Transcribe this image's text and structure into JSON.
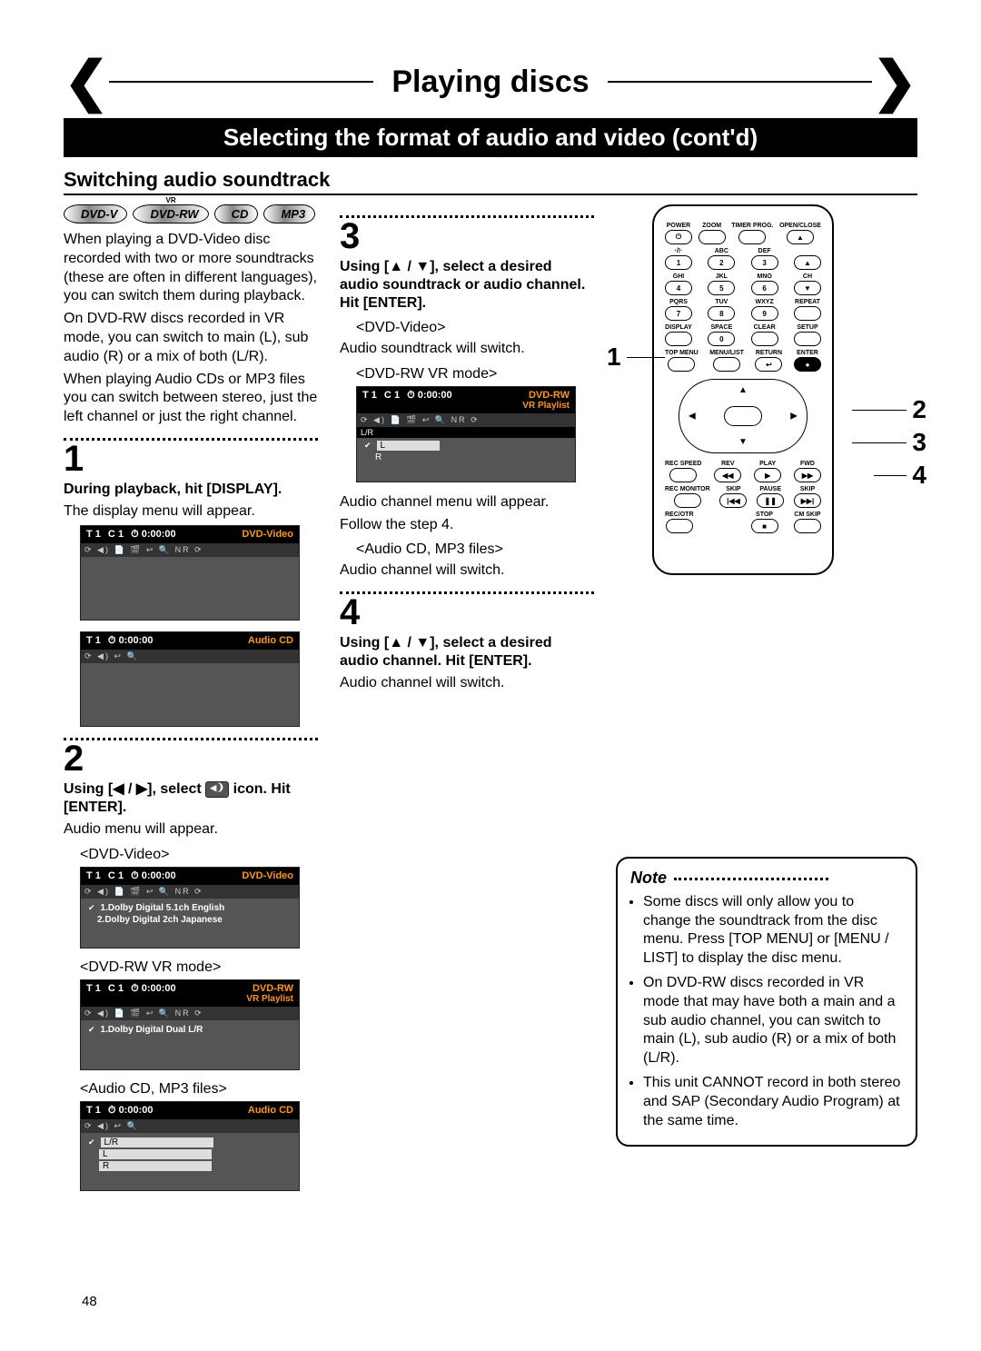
{
  "header": {
    "page_title": "Playing discs",
    "subtitle": "Selecting the format of audio and video (cont'd)",
    "section": "Switching audio soundtrack"
  },
  "badges": [
    "DVD-V",
    "DVD-RW",
    "CD",
    "MP3"
  ],
  "badge_vr": "VR",
  "intro": {
    "p1": "When playing a DVD-Video disc recorded with two or more soundtracks (these are often in different languages), you can switch them during playback.",
    "p2": "On DVD-RW discs recorded in VR mode, you can switch to main (L), sub audio (R) or a mix of both (L/R).",
    "p3": "When playing Audio CDs or MP3 files you can switch between stereo, just the left channel or just the right channel."
  },
  "steps": {
    "s1": {
      "num": "1",
      "heading": "During playback, hit [DISPLAY].",
      "body": "The display menu will appear."
    },
    "s2": {
      "num": "2",
      "heading_a": "Using [◀ / ▶], select ",
      "heading_b": " icon. Hit [ENTER].",
      "body": "Audio menu will appear.",
      "sub1": "<DVD-Video>",
      "sub2": "<DVD-RW VR mode>",
      "sub3": "<Audio CD, MP3 files>"
    },
    "s3": {
      "num": "3",
      "heading": "Using [▲ / ▼], select a desired audio soundtrack or audio channel. Hit [ENTER].",
      "sub1": "<DVD-Video>",
      "body1": "Audio soundtrack will switch.",
      "sub2": "<DVD-RW VR mode>",
      "body2a": "Audio channel menu will appear.",
      "body2b": "Follow the step 4.",
      "sub3": "<Audio CD, MP3 files>",
      "body3": "Audio channel will switch."
    },
    "s4": {
      "num": "4",
      "heading": "Using [▲ / ▼], select a desired audio channel. Hit [ENTER].",
      "body": "Audio channel will switch."
    }
  },
  "osd": {
    "time": "0:00:00",
    "t_label": "T",
    "c_label": "C",
    "one": "1",
    "dvd_video": "DVD-Video",
    "audio_cd": "Audio CD",
    "dvd_rw": "DVD-RW",
    "vr_playlist": "VR Playlist",
    "icons_long": "⟳ ◀) 📄 🎬 ↩ 🔍 NR ⟳",
    "icons_short": "⟳ ◀) ↩ 🔍",
    "dolby1": "1.Dolby Digital 5.1ch English",
    "dolby2": "2.Dolby Digital 2ch Japanese",
    "dolby_dual": "1.Dolby Digital Dual L/R",
    "lr": "L/R",
    "l": "L",
    "r": "R"
  },
  "remote": {
    "row1": [
      "POWER",
      "ZOOM",
      "TIMER PROG.",
      "OPEN/CLOSE"
    ],
    "row2": [
      "·/!·",
      "ABC",
      "DEF",
      ""
    ],
    "row2n": [
      "1",
      "2",
      "3",
      "▲"
    ],
    "row3": [
      "GHI",
      "JKL",
      "MNO",
      "CH"
    ],
    "row3n": [
      "4",
      "5",
      "6",
      "▼"
    ],
    "row4": [
      "PQRS",
      "TUV",
      "WXYZ",
      "REPEAT"
    ],
    "row4n": [
      "7",
      "8",
      "9",
      ""
    ],
    "row5": [
      "DISPLAY",
      "SPACE",
      "CLEAR",
      "SETUP"
    ],
    "row5n": [
      "",
      "0",
      "",
      ""
    ],
    "row6": [
      "TOP MENU",
      "MENU/LIST",
      "RETURN",
      "ENTER"
    ],
    "row7": [
      "REC SPEED",
      "REV",
      "PLAY",
      "FWD"
    ],
    "row8": [
      "REC MONITOR",
      "SKIP",
      "PAUSE",
      "SKIP"
    ],
    "row9": [
      "REC/OTR",
      "",
      "STOP",
      "CM SKIP"
    ]
  },
  "callouts": {
    "c1": "1",
    "c2": "2",
    "c3": "3",
    "c4": "4"
  },
  "note": {
    "title": "Note",
    "items": [
      "Some discs will only allow you to change the soundtrack from the disc menu. Press [TOP MENU] or [MENU / LIST] to display the disc menu.",
      "On DVD-RW discs recorded in VR mode that may have both a main and a sub audio channel, you can switch to main (L), sub audio (R) or a mix of both (L/R).",
      "This unit CANNOT record in both stereo and SAP (Secondary Audio Program) at the same time."
    ]
  },
  "pagenum": "48"
}
